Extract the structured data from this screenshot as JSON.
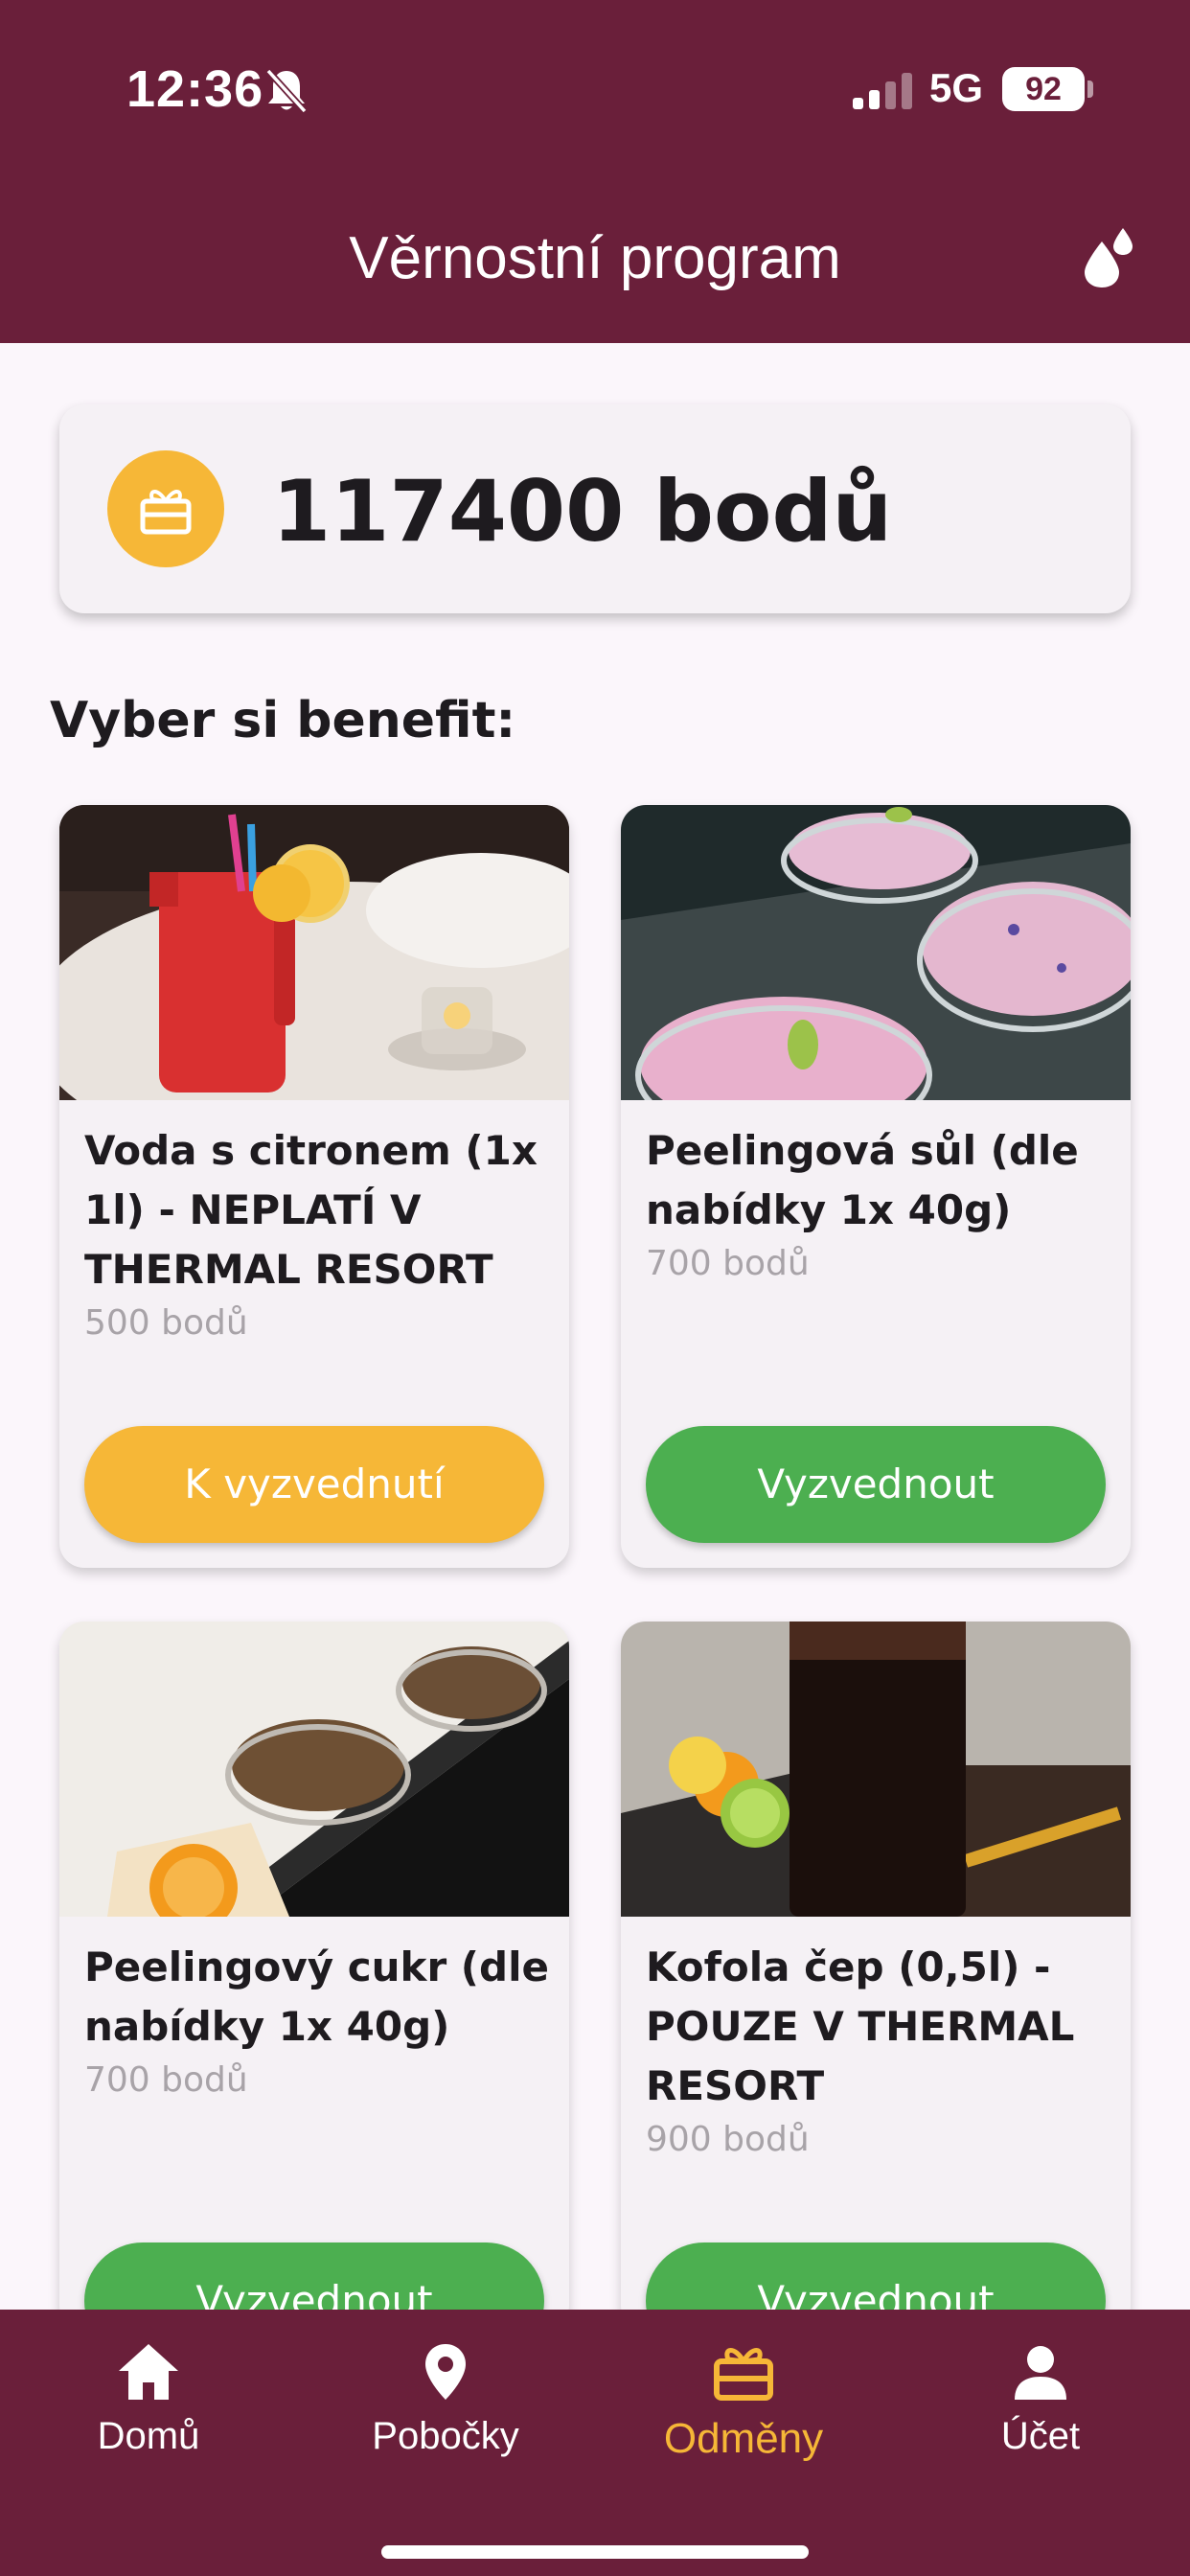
{
  "status_bar": {
    "time": "12:36",
    "network": "5G",
    "battery": "92",
    "icons": [
      "bell-off-icon",
      "signal-icon"
    ]
  },
  "header": {
    "title": "Věrnostní program",
    "action_icon": "drops-icon"
  },
  "points": {
    "value": "117400 bodů",
    "icon": "gift-icon"
  },
  "section_title": "Vyber si benefit:",
  "benefits": [
    {
      "title": "Voda s citronem (1x 1l) - NEPLATÍ V THERMAL RESORT",
      "points": "500 bodů",
      "button": "K vyzvednutí",
      "button_color": "#f6b737",
      "photo": "lemon-water-jug"
    },
    {
      "title": "Peelingová sůl (dle nabídky 1x 40g)",
      "points": "700 bodů",
      "button": "Vyzvednout",
      "button_color": "#4caf50",
      "photo": "pink-salt-bowls"
    },
    {
      "title": "Peelingový cukr (dle nabídky 1x 40g)",
      "points": "700 bodů",
      "button": "Vyzvednout",
      "button_color": "#4caf50",
      "photo": "brown-sugar-bowls"
    },
    {
      "title": "Kofola čep (0,5l) - POUZE V THERMAL RESORT",
      "points": "900 bodů",
      "button": "Vyzvednout",
      "button_color": "#4caf50",
      "photo": "kofola-glass"
    }
  ],
  "nav": [
    {
      "label": "Domů",
      "icon": "home-icon",
      "active": false
    },
    {
      "label": "Pobočky",
      "icon": "location-pin-icon",
      "active": false
    },
    {
      "label": "Odměny",
      "icon": "gift-icon",
      "active": true
    },
    {
      "label": "Účet",
      "icon": "person-icon",
      "active": false
    }
  ],
  "colors": {
    "brand": "#6a1f3a",
    "accent": "#f6b737",
    "success": "#4caf50",
    "background": "#fbf6fb"
  }
}
